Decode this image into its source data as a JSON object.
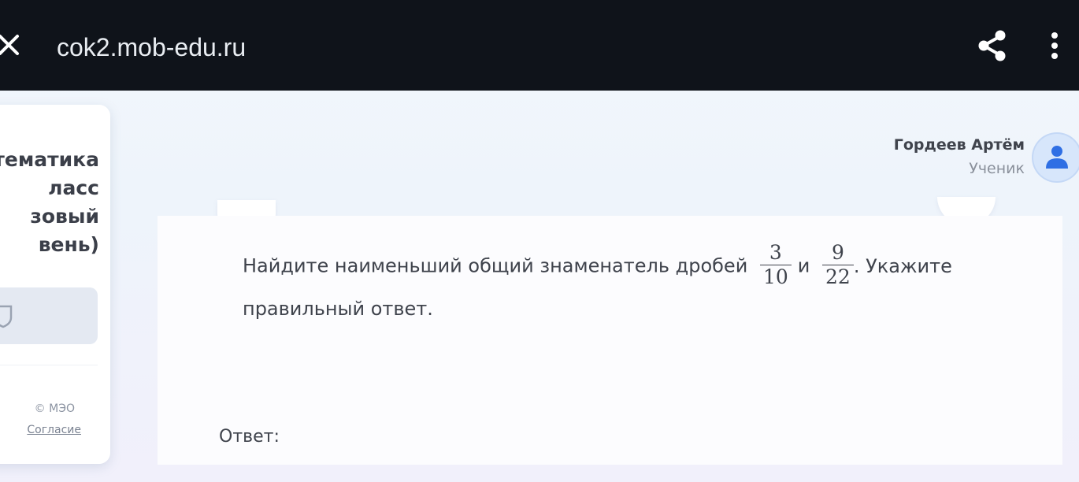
{
  "browser": {
    "url": "cok2.mob-edu.ru"
  },
  "sidebar": {
    "course_title": "тематика\nласс\nзовый\nвень)",
    "copyright": "© МЭО",
    "agreement_link": "Согласие"
  },
  "user": {
    "name": "Гордеев Артём",
    "role": "Ученик"
  },
  "question": {
    "text_before": "Найдите наименьший общий знаменатель дробей",
    "fraction1": {
      "numerator": "3",
      "denominator": "10"
    },
    "conjunction": "и",
    "fraction2": {
      "numerator": "9",
      "denominator": "22"
    },
    "text_after": ". Укажите правильный ответ."
  },
  "answer": {
    "label": "Ответ:"
  },
  "colors": {
    "topbar": "#0f131a",
    "text": "#3f434c",
    "avatar_bg": "#d7e6fb",
    "avatar_figure": "#2f6fe4"
  },
  "icons": [
    "close-icon",
    "share-icon",
    "more-vertical-icon",
    "shield-icon",
    "user-avatar-icon"
  ]
}
